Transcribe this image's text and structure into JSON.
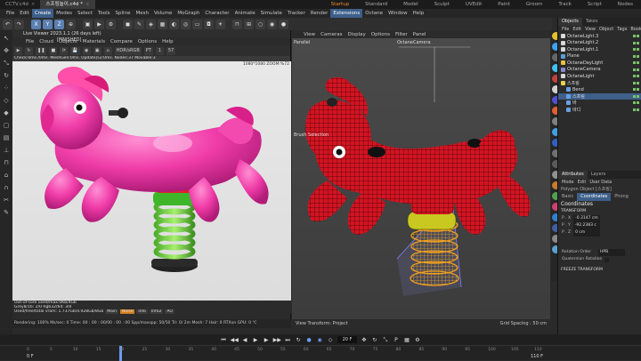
{
  "doc_tabs": [
    {
      "label": "CCTV.c4d",
      "active": false
    },
    {
      "label": "스프링놀이.c4d *",
      "active": true
    }
  ],
  "layouts": [
    {
      "label": "Startup",
      "active": true
    },
    {
      "label": "Standard",
      "active": false
    },
    {
      "label": "Model",
      "active": false
    },
    {
      "label": "Sculpt",
      "active": false
    },
    {
      "label": "UVEdit",
      "active": false
    },
    {
      "label": "Paint",
      "active": false
    },
    {
      "label": "Groom",
      "active": false
    },
    {
      "label": "Track",
      "active": false
    },
    {
      "label": "Script",
      "active": false
    },
    {
      "label": "Nodes",
      "active": false
    }
  ],
  "menu": [
    "File",
    "Edit",
    "Create",
    "Modes",
    "Select",
    "Tools",
    "Spline",
    "Mesh",
    "Volume",
    "MoGraph",
    "Character",
    "Animate",
    "Simulate",
    "Tracker",
    "Render",
    "Extensions",
    "Octane",
    "Window",
    "Help"
  ],
  "menu_highlight": [
    "Create",
    "Extensions"
  ],
  "toolbar_axes": [
    "X",
    "Y",
    "Z"
  ],
  "live_viewer": {
    "title": "Live Viewer 2023.1.1 (26 days left)",
    "menu": [
      "File",
      "Cloud",
      "Objects",
      "Materials",
      "Compare",
      "Options",
      "Help"
    ],
    "finished": "[FINISHED]",
    "mode": "HDR/sRGB",
    "pt": "PT",
    "pt_value": "1",
    "samples": "57",
    "status": "Check:0ms./0ms. MeshGen:0ms. Update[G]:0ms. Nodes:37 Movable:3",
    "resolution": "1080*1080 ZOOM:%72",
    "info_lines": [
      "Out-of-core used/max:0Kb/4Gb",
      "Grey8/16: 2/0    Rgb32/64: 3/0",
      "Used/free/total vram: 1.737Gb/4.928Gb/8Gb"
    ],
    "info_tags": [
      "Main",
      "Noise",
      "Info",
      "Info2",
      "AO"
    ],
    "bottom": "Rendering: 100%  Ms/sec: 0   Time: 00 : 00 : 00/00 : 00 : 00   Spp/maxspp: 50/50   Tri: 0/ 2m   Mesh: 7  Hair: 0   RTXon    GPU: 0 ℃"
  },
  "viewport": {
    "menu": [
      "View",
      "Cameras",
      "Display",
      "Options",
      "Filter",
      "Panel"
    ],
    "projection": "Parallel",
    "camera": "OctaneCamera",
    "brush_label": "Brush Selection",
    "view_transform": "View Transform: Project",
    "grid_spacing": "Grid Spacing : 50 cm"
  },
  "right_panel": {
    "tabs": [
      {
        "label": "Objects",
        "active": true
      },
      {
        "label": "Takes",
        "active": false
      }
    ],
    "menu": [
      "File",
      "Edit",
      "View",
      "Object",
      "Tags",
      "Bookmarks"
    ],
    "objects": [
      {
        "name": "OctaneLight.3",
        "color": "#d8d8d8",
        "indent": 0
      },
      {
        "name": "OctaneLight.2",
        "color": "#d8d8d8",
        "indent": 0
      },
      {
        "name": "OctaneLight.1",
        "color": "#d8d8d8",
        "indent": 0
      },
      {
        "name": "Plane",
        "color": "#5aa0e0",
        "indent": 0
      },
      {
        "name": "OctaneDayLight",
        "color": "#e8c040",
        "indent": 0
      },
      {
        "name": "OctaneCamera",
        "color": "#8888cc",
        "indent": 0
      },
      {
        "name": "OctaneLight",
        "color": "#d8d8d8",
        "indent": 0
      },
      {
        "name": "스프링",
        "color": "#e8d24a",
        "indent": 0
      },
      {
        "name": "Bend",
        "color": "#6aa0e0",
        "indent": 1
      },
      {
        "name": "스프링",
        "color": "#6aa0e0",
        "indent": 1
      },
      {
        "name": "바",
        "color": "#6aa0e0",
        "indent": 1
      },
      {
        "name": "바디",
        "color": "#6aa0e0",
        "indent": 1
      }
    ],
    "attr_tabs": [
      {
        "label": "Attributes",
        "active": true
      },
      {
        "label": "Layers",
        "active": false
      }
    ],
    "attr_menu": [
      "Mode",
      "Edit",
      "User Data"
    ],
    "object_type": "Polygon Object [스프링]",
    "sub_tabs": [
      {
        "label": "Basic",
        "active": false
      },
      {
        "label": "Coordinates",
        "active": true
      },
      {
        "label": "Phong",
        "active": false
      }
    ],
    "section": "Coordinates",
    "transform": "TRANSFORM",
    "fields": [
      {
        "label": "P . X",
        "value": "-0.3147 cm"
      },
      {
        "label": "P . Y",
        "value": "-92.2383 c"
      },
      {
        "label": "P . Z",
        "value": "0 cm"
      }
    ],
    "rotation_order_label": "Rotation Order",
    "rotation_order": "HPB",
    "quaternion_label": "Quaternion Rotation",
    "freeze": "FREEZE TRANSFORM"
  },
  "timeline": {
    "frame": "20 F",
    "start": "0 F",
    "end": "110 F",
    "ticks": [
      "0",
      "5",
      "10",
      "15",
      "20",
      "25",
      "30",
      "35",
      "40",
      "45",
      "50",
      "55",
      "60",
      "65",
      "70",
      "75",
      "80",
      "85",
      "90",
      "95",
      "100",
      "105",
      "110"
    ],
    "current_frame": 20,
    "max_frame": 110
  }
}
